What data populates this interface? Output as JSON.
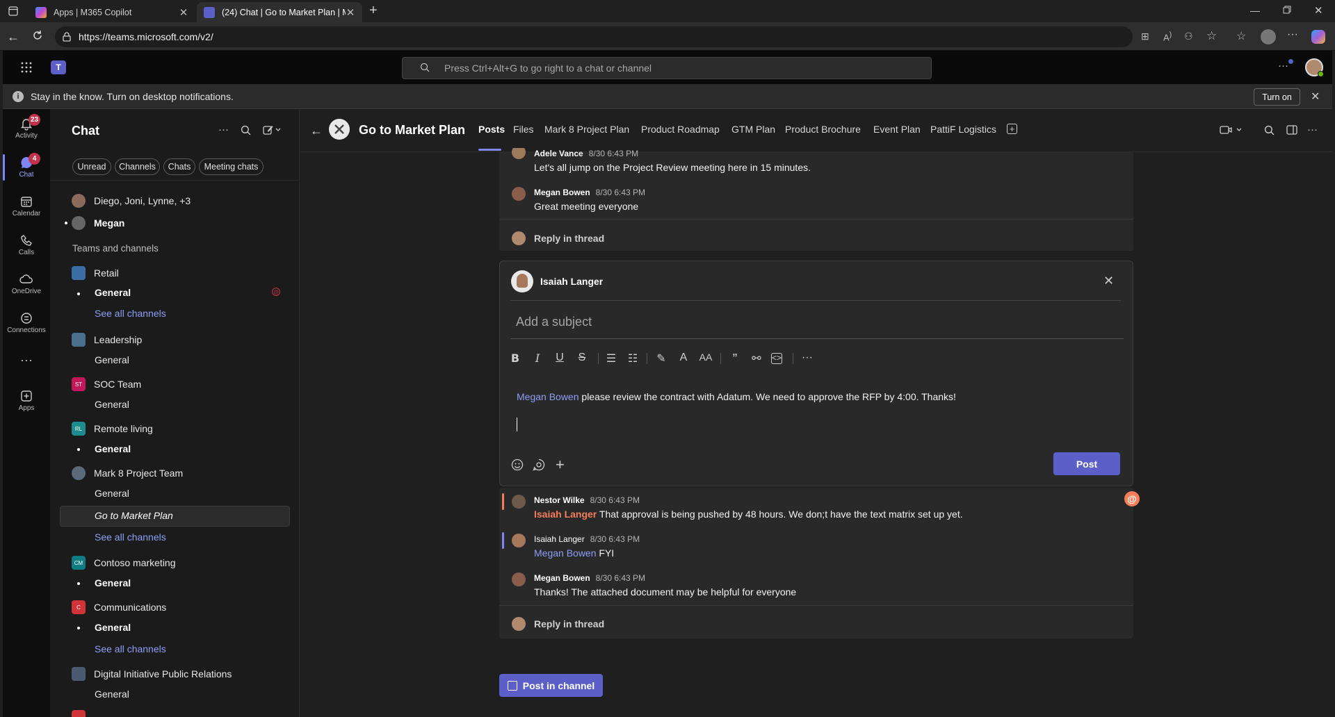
{
  "browser": {
    "tabs": [
      {
        "title": "Apps | M365 Copilot"
      },
      {
        "title": "(24) Chat | Go to Market Plan | M"
      }
    ],
    "url": "https://teams.microsoft.com/v2/"
  },
  "teams_header": {
    "search_placeholder": "Press Ctrl+Alt+G to go right to a chat or channel"
  },
  "notification": {
    "text": "Stay in the know. Turn on desktop notifications.",
    "button": "Turn on"
  },
  "rail": [
    {
      "label": "Activity",
      "badge": "23"
    },
    {
      "label": "Chat",
      "badge": "4"
    },
    {
      "label": "Calendar"
    },
    {
      "label": "Calls"
    },
    {
      "label": "OneDrive"
    },
    {
      "label": "Connections"
    },
    {
      "label": "Apps"
    }
  ],
  "sidebar": {
    "title": "Chat",
    "filters": [
      "Unread",
      "Channels",
      "Chats",
      "Meeting chats"
    ],
    "chats": [
      "Diego, Joni, Lynne, +3",
      "Megan"
    ],
    "section_label": "Teams and channels",
    "teams": [
      {
        "name": "Retail",
        "avatar": "",
        "color": "#3a6ea5",
        "channels": [
          "General"
        ],
        "see_all": "See all channels"
      },
      {
        "name": "Leadership",
        "avatar": "",
        "color": "#4a6f8a",
        "channels": [
          "General"
        ]
      },
      {
        "name": "SOC Team",
        "avatar": "ST",
        "color": "#c2185b",
        "channels": [
          "General"
        ]
      },
      {
        "name": "Remote living",
        "avatar": "RL",
        "color": "#1e8c8c",
        "channels": [
          "General"
        ]
      },
      {
        "name": "Mark 8 Project Team",
        "avatar": "",
        "color": "#5a6a7a",
        "channels": [
          "General",
          "Go to Market Plan"
        ],
        "see_all": "See all channels"
      },
      {
        "name": "Contoso marketing",
        "avatar": "CM",
        "color": "#0f7b83",
        "channels": [
          "General"
        ]
      },
      {
        "name": "Communications",
        "avatar": "C",
        "color": "#d13438",
        "channels": [
          "General"
        ],
        "see_all": "See all channels"
      },
      {
        "name": "Digital Initiative Public Relations",
        "avatar": "",
        "color": "#4a5a70",
        "channels": [
          "General"
        ]
      }
    ]
  },
  "channel": {
    "name": "Go to Market Plan",
    "tabs": [
      "Posts",
      "Files",
      "Mark 8 Project Plan",
      "Product Roadmap",
      "GTM Plan",
      "Product Brochure",
      "Event Plan",
      "PattiF Logistics"
    ]
  },
  "thread1": {
    "messages": [
      {
        "name": "Adele Vance",
        "time": "8/30 6:43 PM",
        "body": "Let's all jump on the Project Review meeting here in 15 minutes."
      },
      {
        "name": "Megan Bowen",
        "time": "8/30 6:43 PM",
        "body": "Great meeting everyone"
      }
    ],
    "reply_label": "Reply in thread"
  },
  "compose": {
    "author": "Isaiah Langer",
    "subject_placeholder": "Add a subject",
    "mention": "Megan Bowen",
    "body": "please review the contract with Adatum. We need to approve the RFP by 4:00. Thanks!",
    "post_label": "Post"
  },
  "thread2": {
    "messages": [
      {
        "name": "Nestor Wilke",
        "time": "8/30 6:43 PM",
        "mention": "Isaiah Langer",
        "body": "That approval is being pushed by 48 hours. We don;t have the text matrix set up yet."
      },
      {
        "name": "Isaiah Langer",
        "time": "8/30 6:43 PM",
        "mention": "Megan Bowen",
        "body": "FYI"
      },
      {
        "name": "Megan Bowen",
        "time": "8/30 6:43 PM",
        "body": "Thanks! The attached document may be helpful for everyone"
      }
    ],
    "reply_label": "Reply in thread"
  },
  "post_in_channel": "Post in channel",
  "colors": {
    "accent": "#5b5fc7",
    "mention": "#8e9ef5",
    "urgent": "#f47d5a",
    "badge": "#c4314b"
  }
}
